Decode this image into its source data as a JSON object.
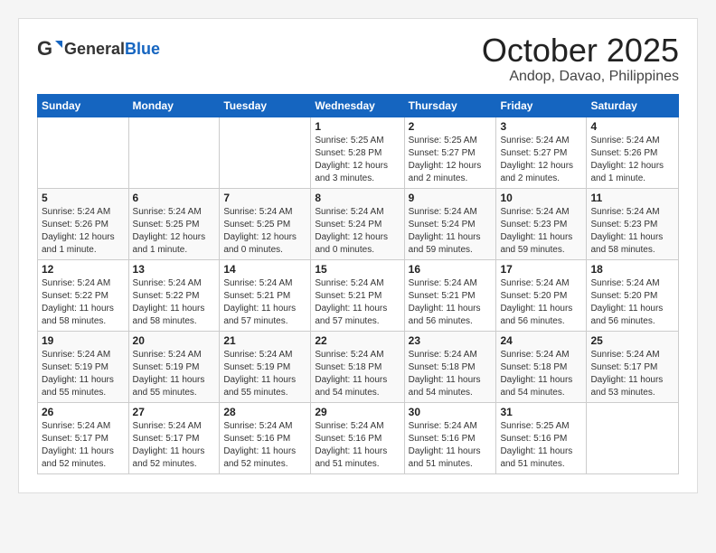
{
  "header": {
    "logo_general": "General",
    "logo_blue": "Blue",
    "month": "October 2025",
    "location": "Andop, Davao, Philippines"
  },
  "weekdays": [
    "Sunday",
    "Monday",
    "Tuesday",
    "Wednesday",
    "Thursday",
    "Friday",
    "Saturday"
  ],
  "weeks": [
    [
      {
        "day": "",
        "info": ""
      },
      {
        "day": "",
        "info": ""
      },
      {
        "day": "",
        "info": ""
      },
      {
        "day": "1",
        "info": "Sunrise: 5:25 AM\nSunset: 5:28 PM\nDaylight: 12 hours\nand 3 minutes."
      },
      {
        "day": "2",
        "info": "Sunrise: 5:25 AM\nSunset: 5:27 PM\nDaylight: 12 hours\nand 2 minutes."
      },
      {
        "day": "3",
        "info": "Sunrise: 5:24 AM\nSunset: 5:27 PM\nDaylight: 12 hours\nand 2 minutes."
      },
      {
        "day": "4",
        "info": "Sunrise: 5:24 AM\nSunset: 5:26 PM\nDaylight: 12 hours\nand 1 minute."
      }
    ],
    [
      {
        "day": "5",
        "info": "Sunrise: 5:24 AM\nSunset: 5:26 PM\nDaylight: 12 hours\nand 1 minute."
      },
      {
        "day": "6",
        "info": "Sunrise: 5:24 AM\nSunset: 5:25 PM\nDaylight: 12 hours\nand 1 minute."
      },
      {
        "day": "7",
        "info": "Sunrise: 5:24 AM\nSunset: 5:25 PM\nDaylight: 12 hours\nand 0 minutes."
      },
      {
        "day": "8",
        "info": "Sunrise: 5:24 AM\nSunset: 5:24 PM\nDaylight: 12 hours\nand 0 minutes."
      },
      {
        "day": "9",
        "info": "Sunrise: 5:24 AM\nSunset: 5:24 PM\nDaylight: 11 hours\nand 59 minutes."
      },
      {
        "day": "10",
        "info": "Sunrise: 5:24 AM\nSunset: 5:23 PM\nDaylight: 11 hours\nand 59 minutes."
      },
      {
        "day": "11",
        "info": "Sunrise: 5:24 AM\nSunset: 5:23 PM\nDaylight: 11 hours\nand 58 minutes."
      }
    ],
    [
      {
        "day": "12",
        "info": "Sunrise: 5:24 AM\nSunset: 5:22 PM\nDaylight: 11 hours\nand 58 minutes."
      },
      {
        "day": "13",
        "info": "Sunrise: 5:24 AM\nSunset: 5:22 PM\nDaylight: 11 hours\nand 58 minutes."
      },
      {
        "day": "14",
        "info": "Sunrise: 5:24 AM\nSunset: 5:21 PM\nDaylight: 11 hours\nand 57 minutes."
      },
      {
        "day": "15",
        "info": "Sunrise: 5:24 AM\nSunset: 5:21 PM\nDaylight: 11 hours\nand 57 minutes."
      },
      {
        "day": "16",
        "info": "Sunrise: 5:24 AM\nSunset: 5:21 PM\nDaylight: 11 hours\nand 56 minutes."
      },
      {
        "day": "17",
        "info": "Sunrise: 5:24 AM\nSunset: 5:20 PM\nDaylight: 11 hours\nand 56 minutes."
      },
      {
        "day": "18",
        "info": "Sunrise: 5:24 AM\nSunset: 5:20 PM\nDaylight: 11 hours\nand 56 minutes."
      }
    ],
    [
      {
        "day": "19",
        "info": "Sunrise: 5:24 AM\nSunset: 5:19 PM\nDaylight: 11 hours\nand 55 minutes."
      },
      {
        "day": "20",
        "info": "Sunrise: 5:24 AM\nSunset: 5:19 PM\nDaylight: 11 hours\nand 55 minutes."
      },
      {
        "day": "21",
        "info": "Sunrise: 5:24 AM\nSunset: 5:19 PM\nDaylight: 11 hours\nand 55 minutes."
      },
      {
        "day": "22",
        "info": "Sunrise: 5:24 AM\nSunset: 5:18 PM\nDaylight: 11 hours\nand 54 minutes."
      },
      {
        "day": "23",
        "info": "Sunrise: 5:24 AM\nSunset: 5:18 PM\nDaylight: 11 hours\nand 54 minutes."
      },
      {
        "day": "24",
        "info": "Sunrise: 5:24 AM\nSunset: 5:18 PM\nDaylight: 11 hours\nand 54 minutes."
      },
      {
        "day": "25",
        "info": "Sunrise: 5:24 AM\nSunset: 5:17 PM\nDaylight: 11 hours\nand 53 minutes."
      }
    ],
    [
      {
        "day": "26",
        "info": "Sunrise: 5:24 AM\nSunset: 5:17 PM\nDaylight: 11 hours\nand 52 minutes."
      },
      {
        "day": "27",
        "info": "Sunrise: 5:24 AM\nSunset: 5:17 PM\nDaylight: 11 hours\nand 52 minutes."
      },
      {
        "day": "28",
        "info": "Sunrise: 5:24 AM\nSunset: 5:16 PM\nDaylight: 11 hours\nand 52 minutes."
      },
      {
        "day": "29",
        "info": "Sunrise: 5:24 AM\nSunset: 5:16 PM\nDaylight: 11 hours\nand 51 minutes."
      },
      {
        "day": "30",
        "info": "Sunrise: 5:24 AM\nSunset: 5:16 PM\nDaylight: 11 hours\nand 51 minutes."
      },
      {
        "day": "31",
        "info": "Sunrise: 5:25 AM\nSunset: 5:16 PM\nDaylight: 11 hours\nand 51 minutes."
      },
      {
        "day": "",
        "info": ""
      }
    ]
  ]
}
